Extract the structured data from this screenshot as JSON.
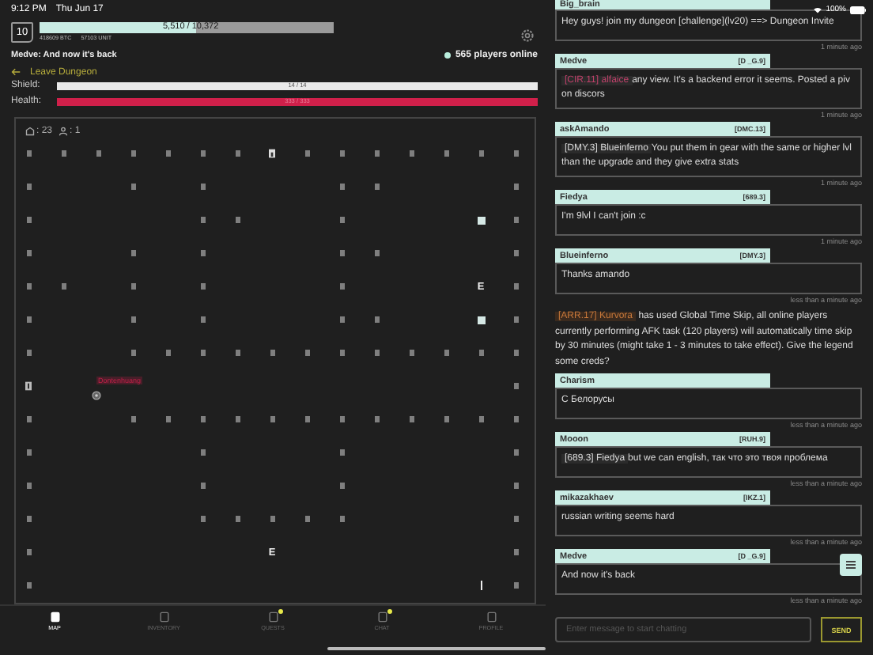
{
  "status_bar": {
    "time": "9:12 PM",
    "date": "Thu Jun 17",
    "battery": "100%"
  },
  "header": {
    "level": "10",
    "xp": {
      "text": "5,510 / 10,372",
      "level": 0.53
    },
    "currency": "418609 BTC",
    "units": "57103 UNIT"
  },
  "last_message": "Medve: And now it's back",
  "players_online": "565 players online",
  "leave_link": "Leave Dungeon",
  "bars": [
    {
      "kind": "shield",
      "label": "Shield:",
      "value": "14 / 14",
      "level": 1
    },
    {
      "kind": "health",
      "label": "Health:",
      "value": "333 / 333",
      "level": 1
    }
  ],
  "map": {
    "rooms": ": 23",
    "players": ": 1",
    "rows": [
      [
        {
          "kind": "room"
        },
        {
          "kind": "room"
        },
        {
          "kind": "room"
        },
        {
          "kind": "room"
        },
        {
          "kind": "room"
        },
        {
          "kind": "room"
        },
        {
          "kind": "room"
        },
        {
          "kind": "door"
        },
        {
          "kind": "room"
        },
        {
          "kind": "room"
        },
        {
          "kind": "room"
        },
        {
          "kind": "room"
        },
        {
          "kind": "room"
        },
        {
          "kind": "room"
        },
        {
          "kind": "room"
        }
      ],
      [
        {
          "kind": "room"
        },
        {
          "kind": "empty"
        },
        {
          "kind": "empty"
        },
        {
          "kind": "room"
        },
        {
          "kind": "empty"
        },
        {
          "kind": "room"
        },
        {
          "kind": "empty"
        },
        {
          "kind": "empty"
        },
        {
          "kind": "empty"
        },
        {
          "kind": "room"
        },
        {
          "kind": "room"
        },
        {
          "kind": "empty"
        },
        {
          "kind": "empty"
        },
        {
          "kind": "empty"
        },
        {
          "kind": "room"
        }
      ],
      [
        {
          "kind": "room"
        },
        {
          "kind": "empty"
        },
        {
          "kind": "empty"
        },
        {
          "kind": "empty"
        },
        {
          "kind": "empty"
        },
        {
          "kind": "room"
        },
        {
          "kind": "room"
        },
        {
          "kind": "empty"
        },
        {
          "kind": "empty"
        },
        {
          "kind": "room"
        },
        {
          "kind": "empty"
        },
        {
          "kind": "empty"
        },
        {
          "kind": "empty"
        },
        {
          "kind": "item"
        },
        {
          "kind": "room"
        }
      ],
      [
        {
          "kind": "room"
        },
        {
          "kind": "empty"
        },
        {
          "kind": "empty"
        },
        {
          "kind": "room"
        },
        {
          "kind": "empty"
        },
        {
          "kind": "room"
        },
        {
          "kind": "empty"
        },
        {
          "kind": "empty"
        },
        {
          "kind": "empty"
        },
        {
          "kind": "room"
        },
        {
          "kind": "room"
        },
        {
          "kind": "empty"
        },
        {
          "kind": "empty"
        },
        {
          "kind": "empty"
        },
        {
          "kind": "room"
        }
      ],
      [
        {
          "kind": "room"
        },
        {
          "kind": "room"
        },
        {
          "kind": "empty"
        },
        {
          "kind": "room"
        },
        {
          "kind": "empty"
        },
        {
          "kind": "room"
        },
        {
          "kind": "empty"
        },
        {
          "kind": "empty"
        },
        {
          "kind": "empty"
        },
        {
          "kind": "room"
        },
        {
          "kind": "empty"
        },
        {
          "kind": "empty"
        },
        {
          "kind": "empty"
        },
        {
          "kind": "exit",
          "label": "E"
        },
        {
          "kind": "room"
        }
      ],
      [
        {
          "kind": "room"
        },
        {
          "kind": "empty"
        },
        {
          "kind": "empty"
        },
        {
          "kind": "room"
        },
        {
          "kind": "empty"
        },
        {
          "kind": "room"
        },
        {
          "kind": "empty"
        },
        {
          "kind": "empty"
        },
        {
          "kind": "empty"
        },
        {
          "kind": "room"
        },
        {
          "kind": "room"
        },
        {
          "kind": "empty"
        },
        {
          "kind": "empty"
        },
        {
          "kind": "item"
        },
        {
          "kind": "room"
        }
      ],
      [
        {
          "kind": "room"
        },
        {
          "kind": "empty"
        },
        {
          "kind": "empty"
        },
        {
          "kind": "room"
        },
        {
          "kind": "room"
        },
        {
          "kind": "room"
        },
        {
          "kind": "room"
        },
        {
          "kind": "room"
        },
        {
          "kind": "room"
        },
        {
          "kind": "room"
        },
        {
          "kind": "room"
        },
        {
          "kind": "room"
        },
        {
          "kind": "room"
        },
        {
          "kind": "room"
        },
        {
          "kind": "room"
        }
      ],
      [
        {
          "kind": "key"
        },
        {
          "kind": "empty"
        },
        {
          "kind": "player",
          "name": "Dontenhuang"
        },
        {
          "kind": "empty"
        },
        {
          "kind": "empty"
        },
        {
          "kind": "empty"
        },
        {
          "kind": "empty"
        },
        {
          "kind": "empty"
        },
        {
          "kind": "empty"
        },
        {
          "kind": "empty"
        },
        {
          "kind": "empty"
        },
        {
          "kind": "empty"
        },
        {
          "kind": "empty"
        },
        {
          "kind": "empty"
        },
        {
          "kind": "room"
        }
      ],
      [
        {
          "kind": "room"
        },
        {
          "kind": "empty"
        },
        {
          "kind": "empty"
        },
        {
          "kind": "room"
        },
        {
          "kind": "room"
        },
        {
          "kind": "room"
        },
        {
          "kind": "room"
        },
        {
          "kind": "room"
        },
        {
          "kind": "room"
        },
        {
          "kind": "room"
        },
        {
          "kind": "room"
        },
        {
          "kind": "room"
        },
        {
          "kind": "room"
        },
        {
          "kind": "room"
        },
        {
          "kind": "room"
        }
      ],
      [
        {
          "kind": "room"
        },
        {
          "kind": "empty"
        },
        {
          "kind": "empty"
        },
        {
          "kind": "empty"
        },
        {
          "kind": "empty"
        },
        {
          "kind": "room"
        },
        {
          "kind": "empty"
        },
        {
          "kind": "empty"
        },
        {
          "kind": "empty"
        },
        {
          "kind": "room"
        },
        {
          "kind": "empty"
        },
        {
          "kind": "empty"
        },
        {
          "kind": "empty"
        },
        {
          "kind": "empty"
        },
        {
          "kind": "room"
        }
      ],
      [
        {
          "kind": "room"
        },
        {
          "kind": "empty"
        },
        {
          "kind": "empty"
        },
        {
          "kind": "empty"
        },
        {
          "kind": "empty"
        },
        {
          "kind": "room"
        },
        {
          "kind": "empty"
        },
        {
          "kind": "empty"
        },
        {
          "kind": "empty"
        },
        {
          "kind": "room"
        },
        {
          "kind": "empty"
        },
        {
          "kind": "empty"
        },
        {
          "kind": "empty"
        },
        {
          "kind": "empty"
        },
        {
          "kind": "room"
        }
      ],
      [
        {
          "kind": "room"
        },
        {
          "kind": "empty"
        },
        {
          "kind": "empty"
        },
        {
          "kind": "empty"
        },
        {
          "kind": "empty"
        },
        {
          "kind": "room"
        },
        {
          "kind": "room"
        },
        {
          "kind": "room"
        },
        {
          "kind": "room"
        },
        {
          "kind": "room"
        },
        {
          "kind": "empty"
        },
        {
          "kind": "empty"
        },
        {
          "kind": "empty"
        },
        {
          "kind": "empty"
        },
        {
          "kind": "room"
        }
      ],
      [
        {
          "kind": "room"
        },
        {
          "kind": "empty"
        },
        {
          "kind": "empty"
        },
        {
          "kind": "empty"
        },
        {
          "kind": "empty"
        },
        {
          "kind": "empty"
        },
        {
          "kind": "empty"
        },
        {
          "kind": "exit",
          "label": "E"
        },
        {
          "kind": "empty"
        },
        {
          "kind": "empty"
        },
        {
          "kind": "empty"
        },
        {
          "kind": "empty"
        },
        {
          "kind": "empty"
        },
        {
          "kind": "empty"
        },
        {
          "kind": "room"
        }
      ],
      [
        {
          "kind": "room"
        },
        {
          "kind": "empty"
        },
        {
          "kind": "empty"
        },
        {
          "kind": "empty"
        },
        {
          "kind": "empty"
        },
        {
          "kind": "empty"
        },
        {
          "kind": "empty"
        },
        {
          "kind": "empty"
        },
        {
          "kind": "empty"
        },
        {
          "kind": "empty"
        },
        {
          "kind": "empty"
        },
        {
          "kind": "empty"
        },
        {
          "kind": "empty"
        },
        {
          "kind": "wall"
        },
        {
          "kind": "room"
        }
      ]
    ]
  },
  "chat": {
    "messages": [
      {
        "kind": "user",
        "author": "Big_brain",
        "text": "Hey guys! join my dungeon [challenge](lv20) ==>  Dungeon Invite",
        "time": "1 minute ago"
      },
      {
        "kind": "user",
        "author": "Medve",
        "tag": "[D _G.9]",
        "mention": {
          "text": "[CIR.11] alfaice",
          "color": "#c0406a"
        },
        "text": "any view. It's a backend error it seems. Posted a piv on discors",
        "time": "1 minute ago"
      },
      {
        "kind": "user",
        "author": "askAmando",
        "tag": "[DMC.13]",
        "mention": {
          "text": "[DMY.3] Blueinferno",
          "color": "#d8d8d8"
        },
        "text": "You put them in gear with the same or higher lvl than the upgrade and they give extra stats",
        "time": "1 minute ago"
      },
      {
        "kind": "user",
        "author": "Fiedya",
        "tag": "[689.3]",
        "text": "I'm 9lvl I can't join :c",
        "time": "1 minute ago"
      },
      {
        "kind": "user",
        "author": "Blueinferno",
        "tag": "[DMY.3]",
        "text": "Thanks amando",
        "time": "less than a minute ago"
      },
      {
        "kind": "system",
        "mention": {
          "text": "[ARR.17] Kurvora",
          "color": "#c8783a"
        },
        "text": "has used Global Time Skip, all online players currently performing AFK task (120 players) will automatically time skip by 30 minutes (might take 1 - 3 minutes to take effect). Give the legend some creds?"
      },
      {
        "kind": "user",
        "author": "Charism",
        "text": "С Белорусы",
        "time": "less than a minute ago"
      },
      {
        "kind": "user",
        "author": "Mooon",
        "tag": "[RUH.9]",
        "mention": {
          "text": "[689.3] Fiedya",
          "color": "#d8d8d8"
        },
        "text": "but we can english, так что это твоя проблема",
        "time": "less than a minute ago"
      },
      {
        "kind": "user",
        "author": "mikazakhaev",
        "tag": "[IKZ.1]",
        "text": "russian writing seems hard",
        "time": "less than a minute ago"
      },
      {
        "kind": "user",
        "author": "Medve",
        "tag": "[D _G.9]",
        "text": "And now it's back",
        "time": "less than a minute ago"
      }
    ],
    "input_placeholder": "Enter message to start chatting",
    "send_label": "SEND"
  },
  "nav": [
    {
      "label": "MAP",
      "selected": true,
      "badge": false
    },
    {
      "label": "INVENTORY",
      "selected": false,
      "badge": false
    },
    {
      "label": "QUESTS",
      "selected": false,
      "badge": true
    },
    {
      "label": "CHAT",
      "selected": false,
      "badge": true
    },
    {
      "label": "PROFILE",
      "selected": false,
      "badge": false
    }
  ]
}
